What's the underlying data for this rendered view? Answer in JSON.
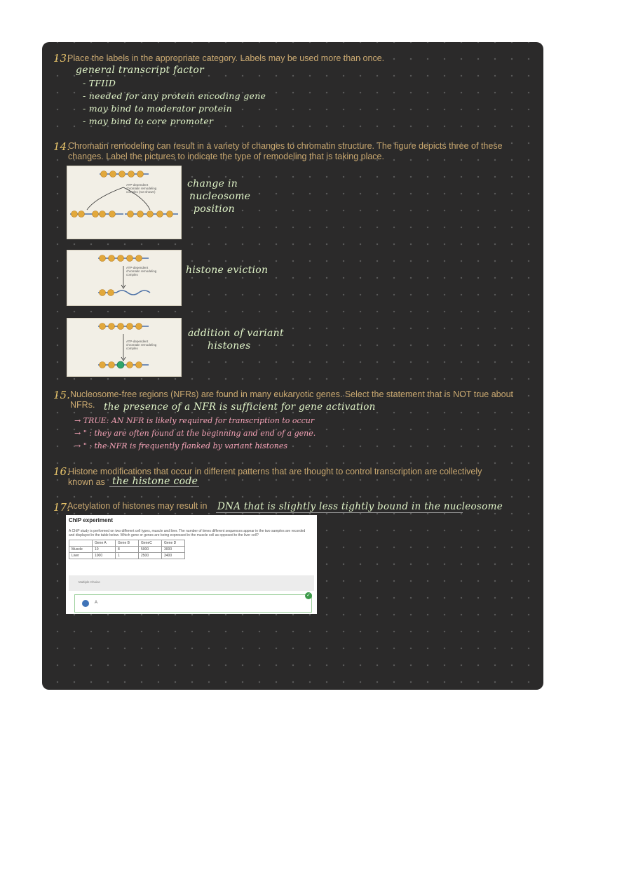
{
  "q13": {
    "num": "13.",
    "text": "Place the labels in the appropriate category.  Labels may be used more than once.",
    "answer_heading": "general transcript factor",
    "answers": [
      "- TFIID",
      "- needed for any protein encoding gene",
      "- may bind to moderator protein",
      "- may bind to core promoter"
    ]
  },
  "q14": {
    "num": "14.",
    "text_line1": "Chromatin remodeling can result in a variety of changes to chromatin structure. The figure depicts three of these",
    "text_line2": "changes. Label the pictures to indicate the type of remodeling that is taking place.",
    "fig1_caption": "ATP-dependent chromatin remodeling complex (not shown)",
    "fig2_caption": "ATP-dependent chromatin remodeling complex",
    "fig3_caption": "ATP-dependent chromatin remodeling complex",
    "label1": [
      "change in",
      "nucleosome",
      "position"
    ],
    "label2": "histone eviction",
    "label3": [
      "addition of variant",
      "histones"
    ]
  },
  "q15": {
    "num": "15.",
    "text_line1": "Nucleosome-free regions (NFRs) are found in many eukaryotic genes. Select the statement that is NOT true about",
    "text_line2": "NFRs.",
    "answer": "the presence of a NFR is sufficient for gene activation",
    "notes": [
      "→ TRUE: AN NFR is likely required for transcription to occur",
      "→   \" : they are often found at the beginning and end of a gene.",
      "→   \" : the NFR is frequently flanked by variant histones"
    ]
  },
  "q16": {
    "num": "16.",
    "text_line1": "Histone modifications that occur in different patterns that are thought to control transcription are collectively",
    "text_line2": "known as",
    "answer": "the histone code"
  },
  "q17": {
    "num": "17.",
    "text": "Acetylation of histones may result in",
    "answer": "DNA that is slightly less tightly bound in the nucleosome"
  },
  "chip": {
    "title": "ChIP experiment",
    "description": "A ChIP study is performed on two different cell types, muscle and liver. The number of times different sequences appear in the two samples are recorded and displayed in the table below. Which gene or genes are being expressed in the muscle cell as opposed to the liver cell?",
    "header": [
      "",
      "Gene A",
      "Gene B",
      "GeneC",
      "Gene D"
    ],
    "rows": [
      [
        "Muscle",
        "10",
        "8",
        "5000",
        "3000"
      ],
      [
        "Liver",
        "1000",
        "1",
        "2500",
        "3400"
      ]
    ],
    "band_label": "Multiple Choice",
    "answer_option": "A"
  },
  "colors": {
    "board": "#2b2a2a",
    "question_text": "#c9a870",
    "handwriting_green": "#e0f4c8",
    "handwriting_pink": "#f4a2b6"
  }
}
